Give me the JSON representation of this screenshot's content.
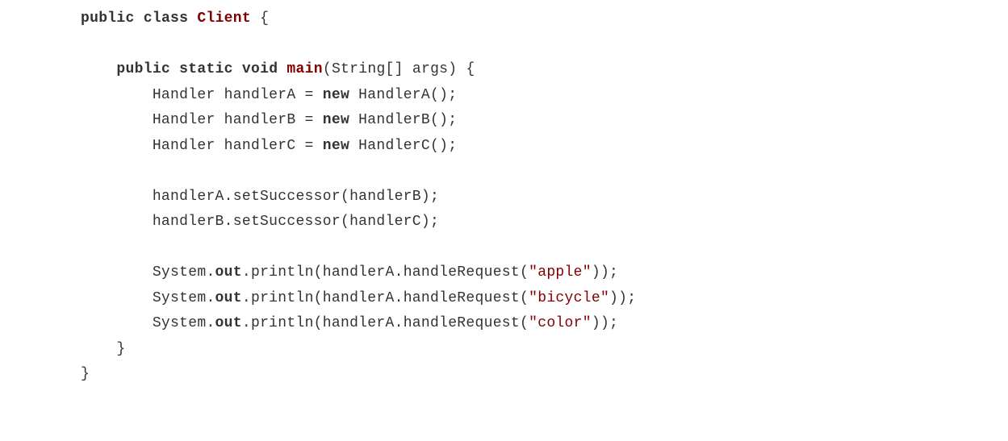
{
  "code": {
    "kw_public": "public",
    "kw_class": "class",
    "kw_static": "static",
    "kw_void": "void",
    "kw_new": "new",
    "cls_client": "Client",
    "mth_main": "main",
    "sig_string_arr": "(String[] args) {",
    "brace_open": " {",
    "brace_close": "}",
    "indent1": "    ",
    "indent2": "        ",
    "decl_handlerA_left": "Handler handlerA = ",
    "decl_handlerA_right": " HandlerA();",
    "decl_handlerB_left": "Handler handlerB = ",
    "decl_handlerB_right": " HandlerB();",
    "decl_handlerC_left": "Handler handlerC = ",
    "decl_handlerC_right": " HandlerC();",
    "set_succ_1": "handlerA.setSuccessor(handlerB);",
    "set_succ_2": "handlerB.setSuccessor(handlerC);",
    "sys_prefix": "System.",
    "sys_out": "out",
    "println_open": ".println(handlerA.handleRequest(",
    "println_close": "));",
    "str_apple": "\"apple\"",
    "str_bicycle": "\"bicycle\"",
    "str_color": "\"color\""
  }
}
